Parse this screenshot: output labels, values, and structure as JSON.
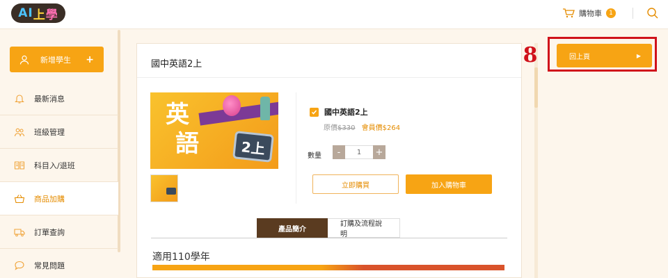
{
  "header": {
    "logo": {
      "part_a": "AI",
      "part_b": "上",
      "part_c": "學"
    },
    "cart_label": "購物車",
    "cart_count": "1"
  },
  "sidebar": {
    "add_student_label": "新增學生",
    "add_student_plus": "+",
    "items": [
      {
        "label": "最新消息",
        "icon": "bell-icon",
        "active": false
      },
      {
        "label": "班級管理",
        "icon": "people-icon",
        "active": false
      },
      {
        "label": "科目入/退班",
        "icon": "book-icon",
        "active": false
      },
      {
        "label": "商品加購",
        "icon": "basket-icon",
        "active": true
      },
      {
        "label": "訂單查詢",
        "icon": "truck-icon",
        "active": false
      },
      {
        "label": "常見問題",
        "icon": "chat-bubble-icon",
        "active": false
      }
    ]
  },
  "product": {
    "title": "國中英語2上",
    "hero_char1": "英",
    "hero_char2": "語",
    "hero_tv_text": "2上",
    "option_name": "國中英語2上",
    "original_price_label": "原價",
    "original_price": "$330",
    "member_price_label": "會員價",
    "member_price": "$264",
    "qty_label": "數量",
    "qty_minus": "-",
    "qty_value": "1",
    "qty_plus": "+",
    "buy_now": "立即購買",
    "add_to_cart": "加入購物車"
  },
  "tabs": [
    {
      "label": "產品簡介",
      "active": true
    },
    {
      "label": "訂購及流程說明",
      "active": false
    }
  ],
  "detail": {
    "grade_text": "適用110學年"
  },
  "back_button": {
    "label": "回上頁",
    "arrow": "▶"
  },
  "annotation": {
    "step": "8",
    "color": "#d0121b"
  },
  "colors": {
    "accent": "#f7a414",
    "tab_active": "#5a3b20",
    "background": "#fdf6ec"
  }
}
